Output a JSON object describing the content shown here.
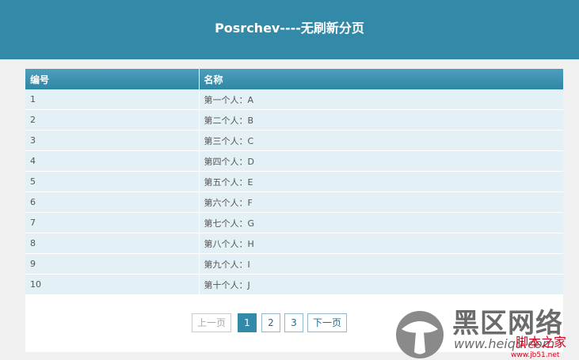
{
  "header": {
    "title": "Posrchev----无刷新分页"
  },
  "table": {
    "columns": [
      "编号",
      "名称"
    ],
    "rows": [
      {
        "id": "1",
        "name": "第一个人：A"
      },
      {
        "id": "2",
        "name": "第二个人：B"
      },
      {
        "id": "3",
        "name": "第三个人：C"
      },
      {
        "id": "4",
        "name": "第四个人：D"
      },
      {
        "id": "5",
        "name": "第五个人：E"
      },
      {
        "id": "6",
        "name": "第六个人：F"
      },
      {
        "id": "7",
        "name": "第七个人：G"
      },
      {
        "id": "8",
        "name": "第八个人：H"
      },
      {
        "id": "9",
        "name": "第九个人：I"
      },
      {
        "id": "10",
        "name": "第十个人：J"
      }
    ]
  },
  "pager": {
    "prev_label": "上一页",
    "pages": [
      "1",
      "2",
      "3"
    ],
    "current_page": "1",
    "next_label": "下一页"
  },
  "watermark": {
    "title": "黑区网络",
    "url": "www.heiqu.com",
    "brand": "脚本之家",
    "small": "www.jb51.net",
    "icon": "mushroom-logo-icon"
  },
  "colors": {
    "header_bg": "#338aa8",
    "row_bg": "#e3f0f5",
    "page_bg": "#f0f0f0",
    "accent_red": "#d0021b"
  }
}
